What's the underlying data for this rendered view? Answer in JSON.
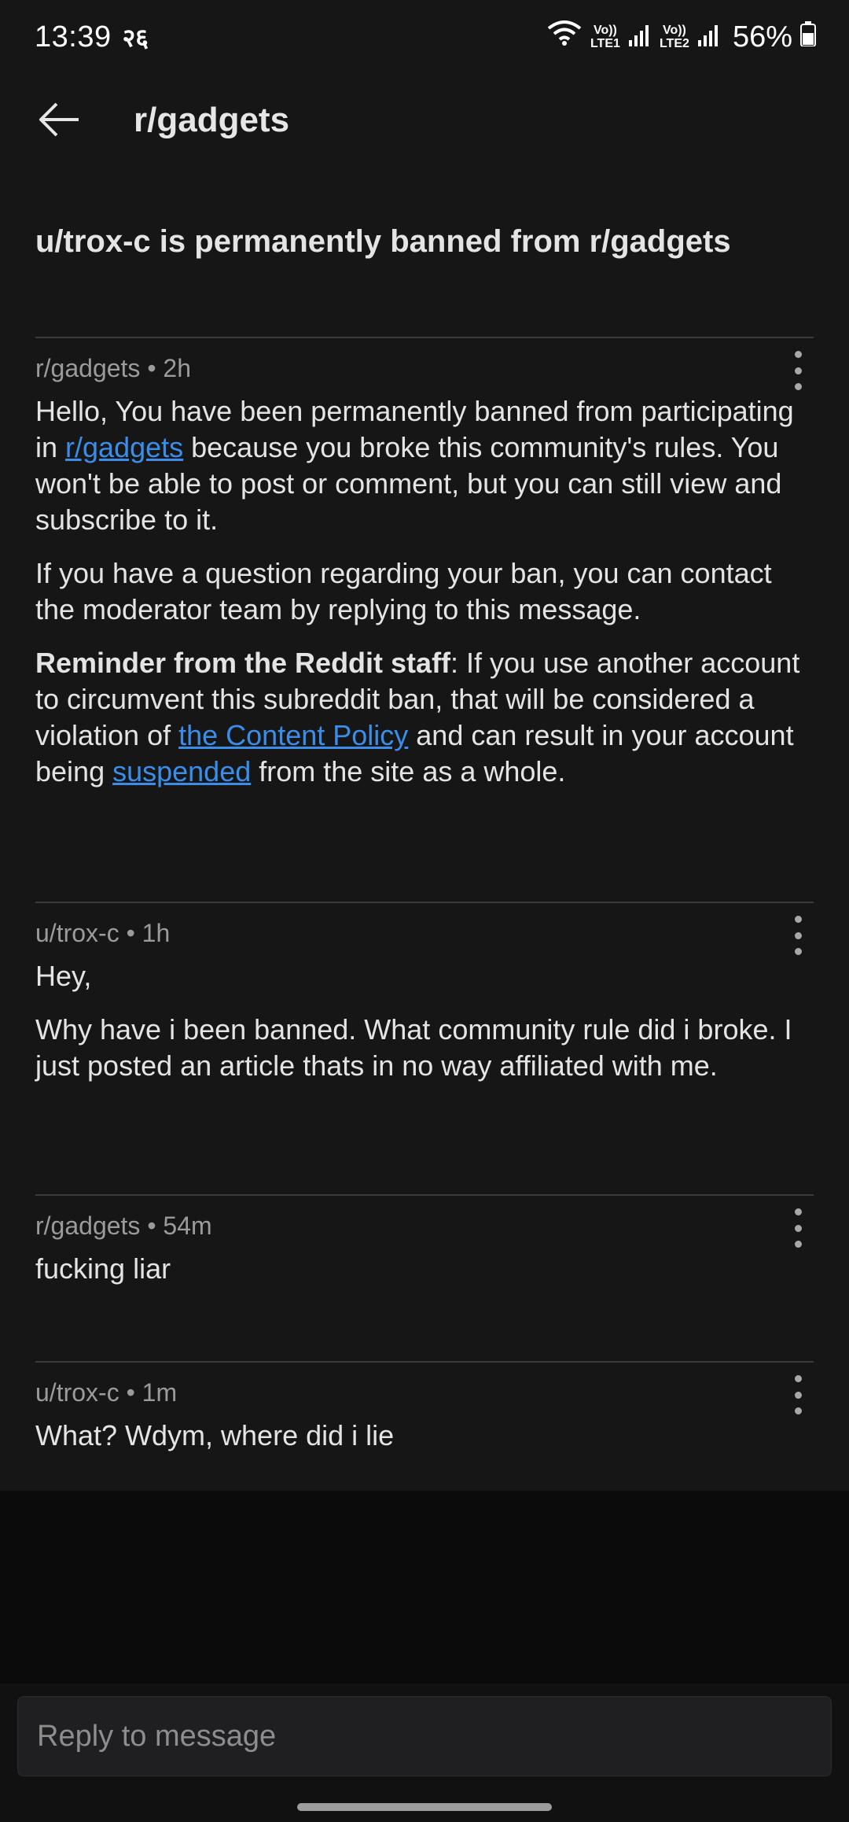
{
  "status_bar": {
    "time": "13:39",
    "extra": "२६",
    "sim1_label": "Vo)) LTE1",
    "sim2_label": "Vo)) LTE2",
    "battery": "56%"
  },
  "header": {
    "title": "r/gadgets"
  },
  "subject": "u/trox-c is permanently banned from r/gadgets",
  "messages": [
    {
      "meta": "r/gadgets • 2h",
      "p1_pre": "Hello, You have been permanently banned from participating in ",
      "p1_link": "r/gadgets",
      "p1_post": " because you broke this community's rules. You won't be able to post or comment, but you can still view and subscribe to it.",
      "p2": "If you have a question regarding your ban, you can contact the moderator team by replying to this message.",
      "p3_bold": "Reminder from the Reddit staff",
      "p3_a": ": If you use another account to circumvent this subreddit ban, that will be considered a violation of ",
      "p3_link1": "the Content Policy",
      "p3_b": " and can result in your account being ",
      "p3_link2": "suspended",
      "p3_c": " from the site as a whole."
    },
    {
      "meta": "u/trox-c • 1h",
      "p1": "Hey,",
      "p2": "Why have i been banned. What community rule did i broke. I just posted an article thats in no way affiliated with me."
    },
    {
      "meta": "r/gadgets • 54m",
      "p1": "fucking liar"
    },
    {
      "meta": "u/trox-c • 1m",
      "p1": "What? Wdym, where did i lie"
    }
  ],
  "reply": {
    "placeholder": "Reply to message"
  },
  "colors": {
    "background": "#161617",
    "link": "#3a8eea",
    "divider": "#3a3a3c",
    "meta_text": "#9b9b9b"
  },
  "icons": [
    "back-arrow-icon",
    "more-vertical-icon",
    "wifi-icon",
    "signal-icon",
    "battery-icon"
  ]
}
